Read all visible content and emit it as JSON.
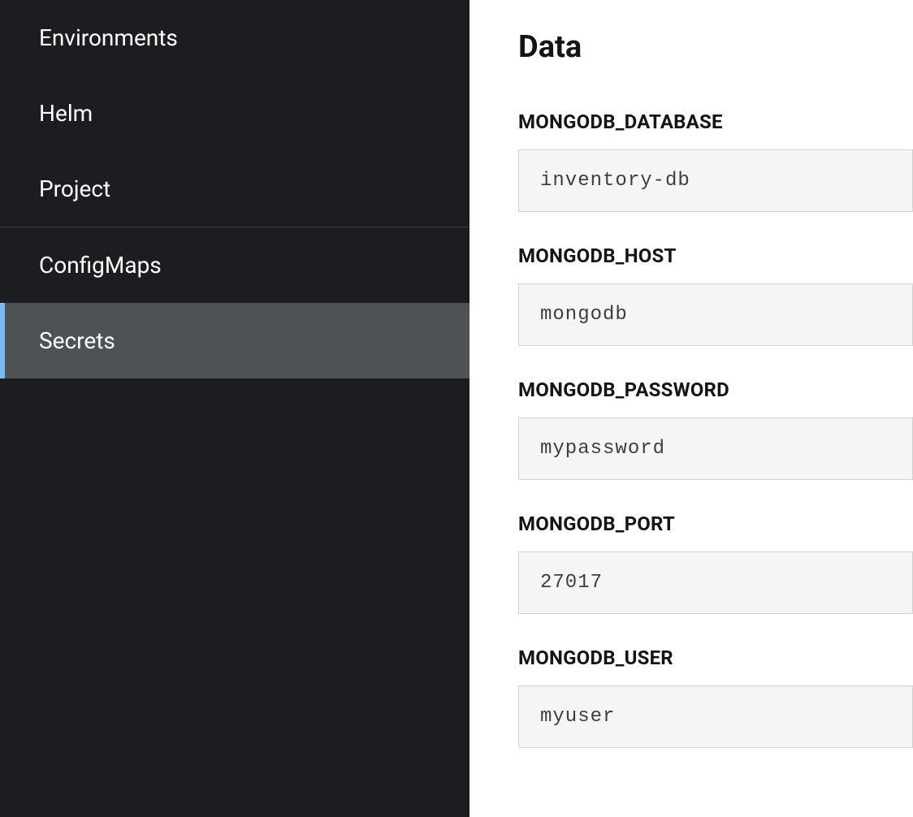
{
  "sidebar": {
    "items": [
      {
        "label": "Environments",
        "active": false
      },
      {
        "label": "Helm",
        "active": false
      },
      {
        "label": "Project",
        "active": false
      },
      {
        "label": "ConfigMaps",
        "active": false
      },
      {
        "label": "Secrets",
        "active": true
      }
    ]
  },
  "main": {
    "heading": "Data",
    "fields": [
      {
        "key": "MONGODB_DATABASE",
        "value": "inventory-db"
      },
      {
        "key": "MONGODB_HOST",
        "value": "mongodb"
      },
      {
        "key": "MONGODB_PASSWORD",
        "value": "mypassword"
      },
      {
        "key": "MONGODB_PORT",
        "value": "27017"
      },
      {
        "key": "MONGODB_USER",
        "value": "myuser"
      }
    ]
  }
}
